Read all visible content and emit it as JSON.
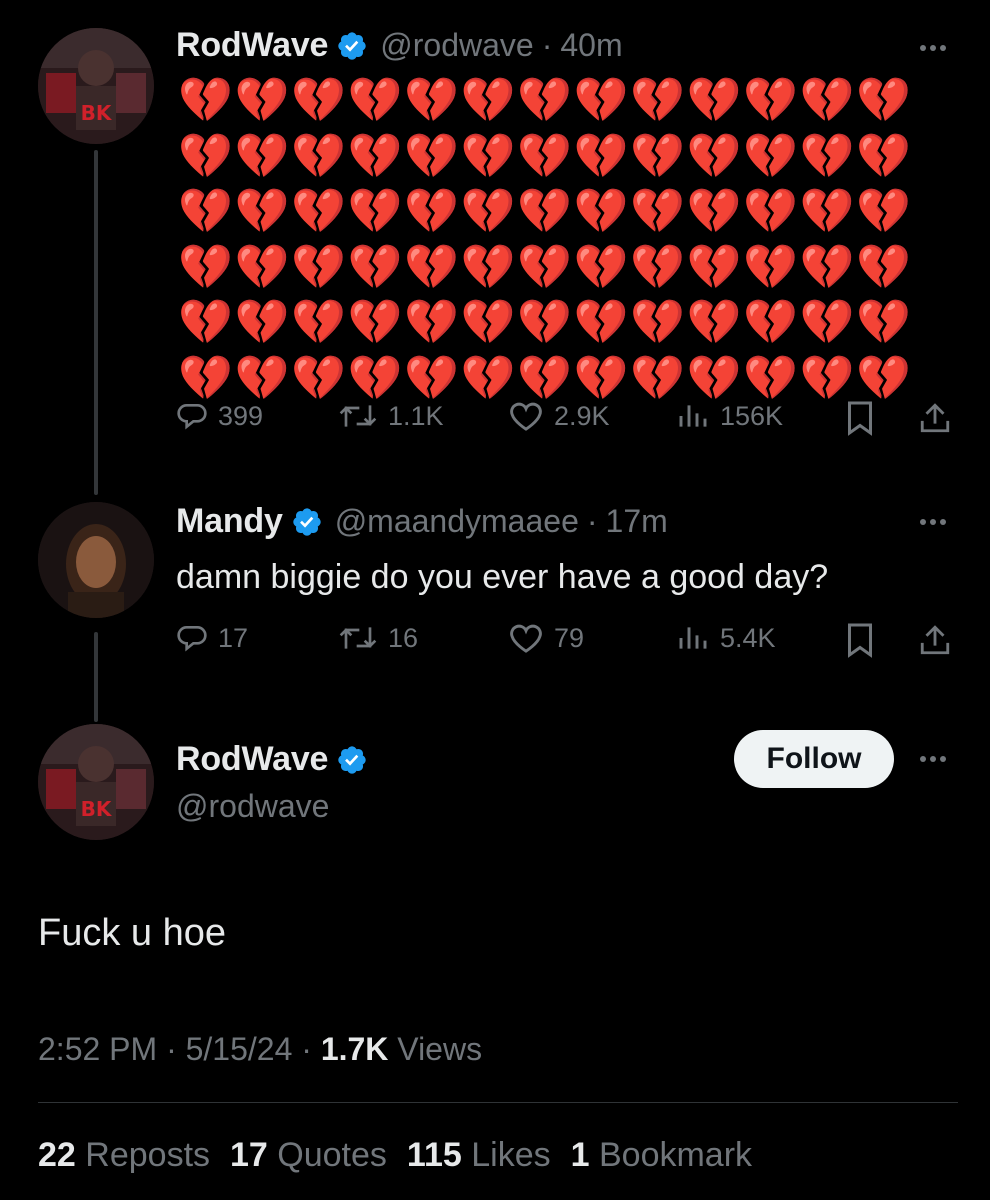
{
  "tweets": [
    {
      "name": "RodWave",
      "handle": "@rodwave",
      "time": "40m",
      "text_emoji": "💔",
      "emoji_count": 78,
      "stats": {
        "replies": "399",
        "reposts": "1.1K",
        "likes": "2.9K",
        "views": "156K"
      }
    },
    {
      "name": "Mandy",
      "handle": "@maandymaaee",
      "time": "17m",
      "text": "damn biggie do you ever have a good day?",
      "stats": {
        "replies": "17",
        "reposts": "16",
        "likes": "79",
        "views": "5.4K"
      }
    }
  ],
  "main": {
    "name": "RodWave",
    "handle": "@rodwave",
    "follow_label": "Follow",
    "text": "Fuck u hoe",
    "time": "2:52 PM",
    "date": "5/15/24",
    "views_count": "1.7K",
    "views_label": "Views",
    "reposts_count": "22",
    "reposts_label": "Reposts",
    "quotes_count": "17",
    "quotes_label": "Quotes",
    "likes_count": "115",
    "likes_label": "Likes",
    "bookmarks_count": "1",
    "bookmarks_label": "Bookmark"
  },
  "separator": "·",
  "colors": {
    "background": "#000000",
    "verified": "#1d9bf0",
    "muted": "#71767b",
    "text": "#e7e9ea",
    "heart": "#f4212e"
  }
}
